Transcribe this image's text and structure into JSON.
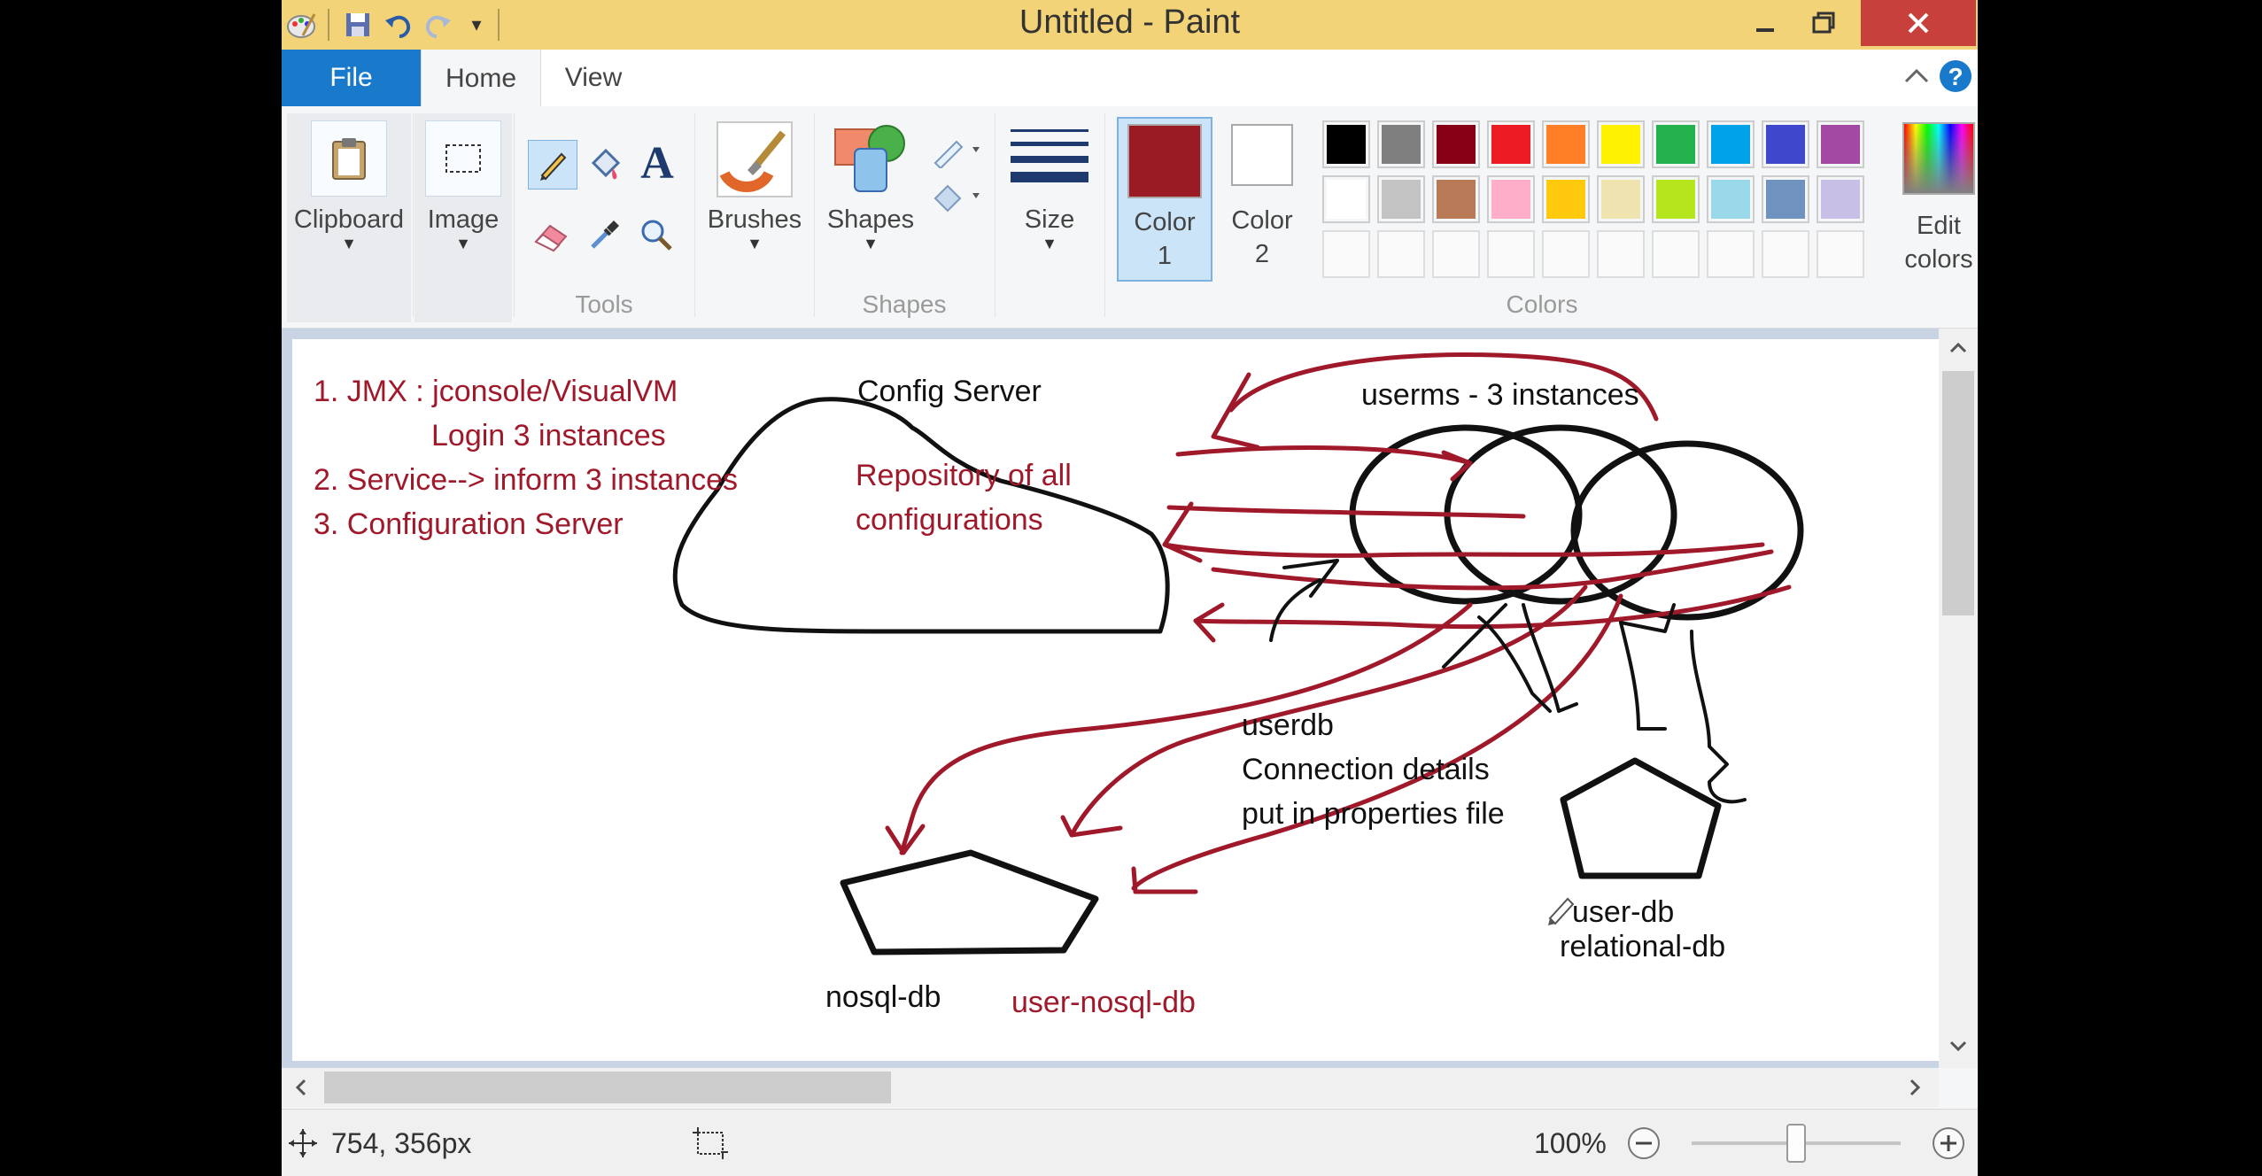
{
  "window": {
    "title": "Untitled - Paint"
  },
  "tabs": {
    "file": "File",
    "home": "Home",
    "view": "View"
  },
  "ribbon": {
    "clipboard": "Clipboard",
    "image": "Image",
    "tools_group": "Tools",
    "brushes": "Brushes",
    "shapes": "Shapes",
    "shapes_group": "Shapes",
    "size": "Size",
    "color1_line1": "Color",
    "color1_line2": "1",
    "color2_line1": "Color",
    "color2_line2": "2",
    "edit_colors_line1": "Edit",
    "edit_colors_line2": "colors",
    "colors_group": "Colors",
    "color1_value": "#9b1b24",
    "color2_value": "#ffffff",
    "palette_row1": [
      "#000000",
      "#7f7f7f",
      "#880015",
      "#ed1c24",
      "#ff7f27",
      "#fff200",
      "#22b14c",
      "#00a2e8",
      "#3f48cc",
      "#a349a4"
    ],
    "palette_row2": [
      "#ffffff",
      "#c3c3c3",
      "#b97a57",
      "#ffaec9",
      "#ffc90e",
      "#efe4b0",
      "#b5e61d",
      "#99d9ea",
      "#7092be",
      "#c8bfe7"
    ]
  },
  "canvas": {
    "notes": [
      "1. JMX : jconsole/VisualVM",
      "Login 3 instances",
      "2. Service--> inform 3 instances",
      "3. Configuration Server"
    ],
    "config_server_label": "Config Server",
    "repository_line1": "Repository of all",
    "repository_line2": "configurations",
    "userms_label": "userms - 3 instances",
    "userdb_line1": "userdb",
    "userdb_line2": "Connection details",
    "userdb_line3": "put in properties file",
    "user_db_label": "user-db",
    "relational_db_label": "relational-db",
    "nosql_db_label": "nosql-db",
    "user_nosql_db_label": "user-nosql-db"
  },
  "status": {
    "cursor_position": "754, 356px",
    "zoom": "100%",
    "zoom_level": 0.5
  }
}
